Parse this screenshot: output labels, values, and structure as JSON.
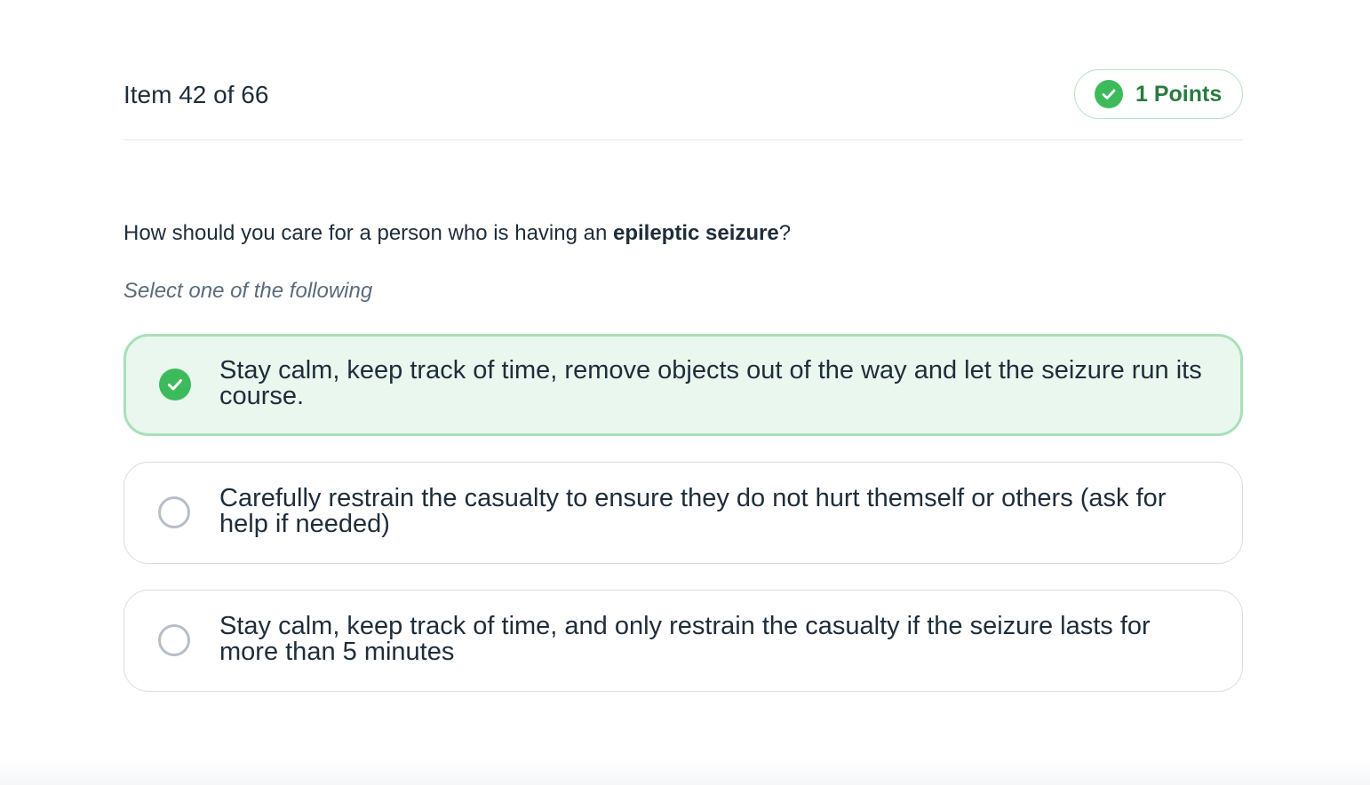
{
  "header": {
    "item_counter": "Item 42 of 66",
    "points_label": "1 Points",
    "points_icon": "check-circle-icon"
  },
  "question": {
    "text_before": "How should you care for a person who is having an ",
    "text_bold": "epileptic seizure",
    "text_after": "?"
  },
  "instructions": "Select one of the following",
  "options": [
    {
      "label": "Stay calm, keep track of time, remove objects out of the way and let the seizure run its course.",
      "selected": true
    },
    {
      "label": "Carefully restrain the casualty to ensure they do not hurt themself or others (ask for help if needed)",
      "selected": false
    },
    {
      "label": "Stay calm, keep track of time, and only restrain the casualty if the seizure lasts for more than 5 minutes",
      "selected": false
    }
  ],
  "colors": {
    "accent_green": "#3dbb5c",
    "selected_bg": "#e9f7ee",
    "selected_border": "#a8e0b8",
    "text": "#1f2d3a"
  }
}
